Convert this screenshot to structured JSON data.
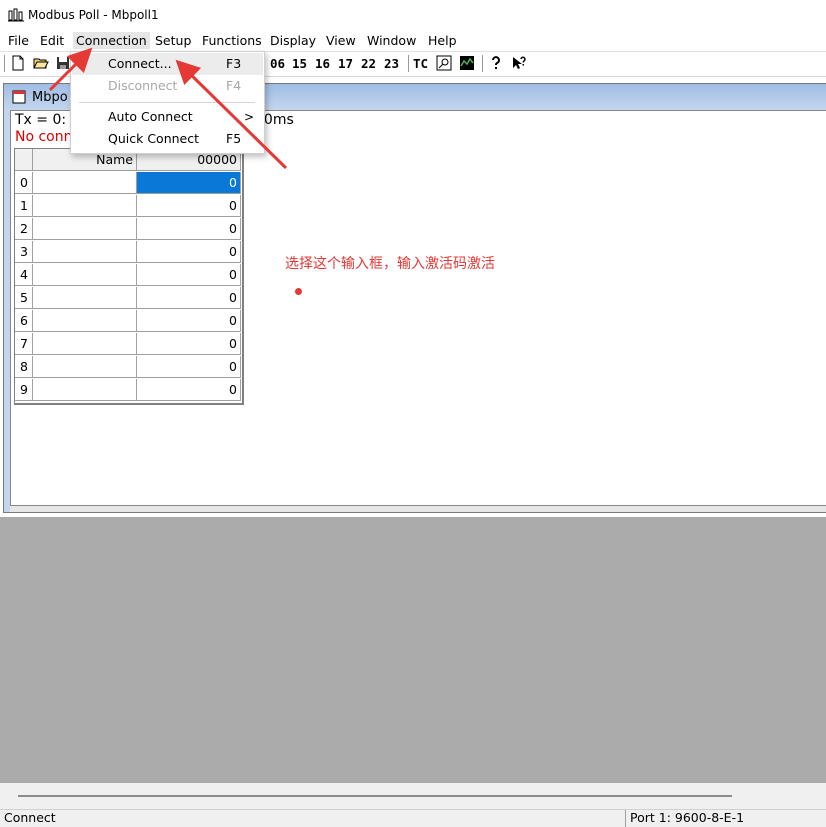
{
  "window": {
    "title": "Modbus Poll - Mbpoll1"
  },
  "menu": [
    {
      "label": "File"
    },
    {
      "label": "Edit"
    },
    {
      "label": "Connection"
    },
    {
      "label": "Setup"
    },
    {
      "label": "Functions"
    },
    {
      "label": "Display"
    },
    {
      "label": "View"
    },
    {
      "label": "Window"
    },
    {
      "label": "Help"
    }
  ],
  "toolbar": {
    "function_codes": [
      "06",
      "15",
      "16",
      "17",
      "22",
      "23"
    ],
    "tc_label": "TC"
  },
  "connection_menu": {
    "items": [
      {
        "label": "Connect...",
        "shortcut": "F3"
      },
      {
        "label": "Disconnect",
        "shortcut": "F4"
      },
      {
        "label": "Auto Connect",
        "submenu_arrow": ">"
      },
      {
        "label": "Quick Connect",
        "shortcut": "F5"
      }
    ]
  },
  "child_window": {
    "title": "Mbpo",
    "status_tx": "Tx = 0: E",
    "status_tx_tail": "00ms",
    "status_conn": "No conne"
  },
  "table": {
    "header_name": "Name",
    "header_value": "00000",
    "rows": [
      {
        "index": "0",
        "name": "",
        "value": "0"
      },
      {
        "index": "1",
        "name": "",
        "value": "0"
      },
      {
        "index": "2",
        "name": "",
        "value": "0"
      },
      {
        "index": "3",
        "name": "",
        "value": "0"
      },
      {
        "index": "4",
        "name": "",
        "value": "0"
      },
      {
        "index": "5",
        "name": "",
        "value": "0"
      },
      {
        "index": "6",
        "name": "",
        "value": "0"
      },
      {
        "index": "7",
        "name": "",
        "value": "0"
      },
      {
        "index": "8",
        "name": "",
        "value": "0"
      },
      {
        "index": "9",
        "name": "",
        "value": "0"
      }
    ]
  },
  "annotation": {
    "text": "选择这个输入框，输入激活码激活",
    "color": "#e53935"
  },
  "statusbar": {
    "left": "Connect",
    "right": "Port 1: 9600-8-E-1"
  },
  "colors": {
    "selection": "#0a78d7",
    "error_text": "#e00000",
    "mdi_background": "#ababab"
  }
}
